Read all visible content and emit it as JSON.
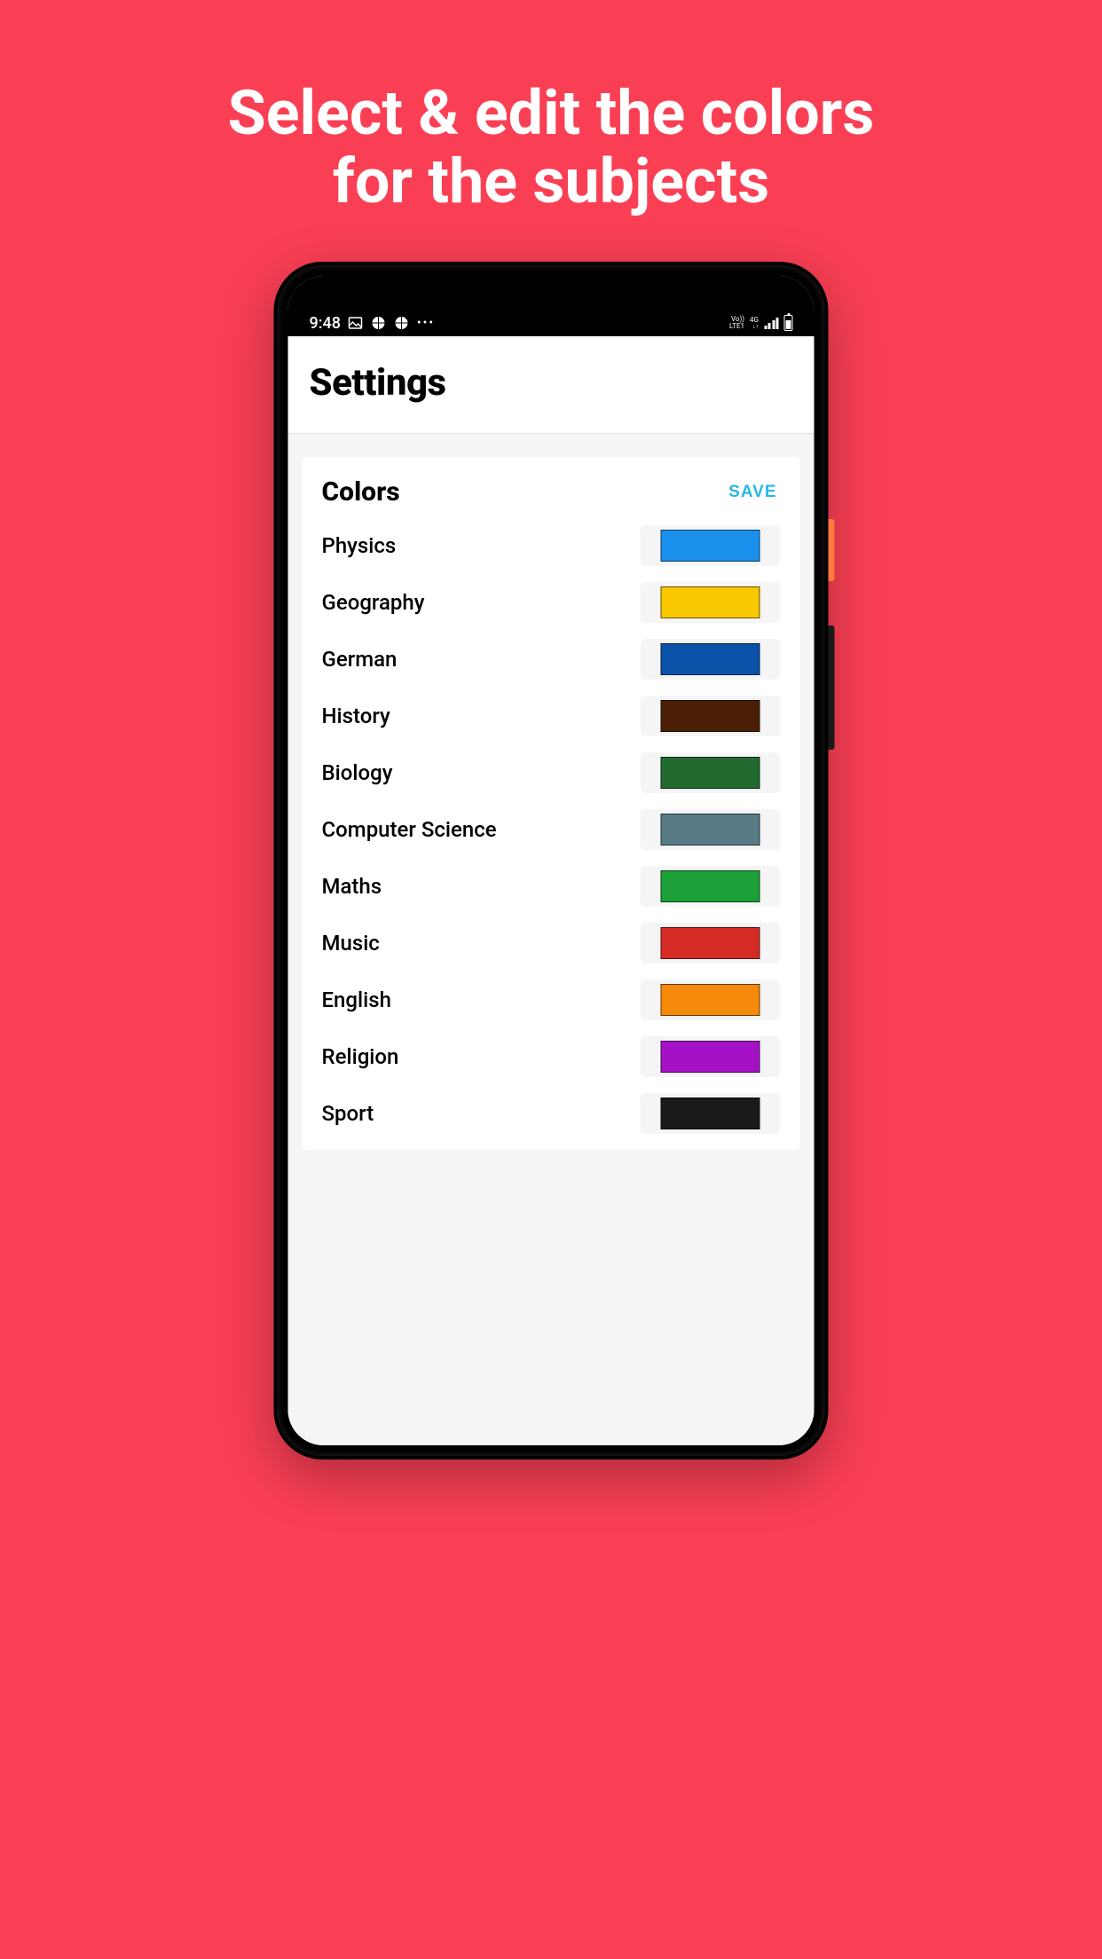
{
  "promo": {
    "title_line1": "Select & edit the colors",
    "title_line2": "for the subjects"
  },
  "status_bar": {
    "time": "9:48",
    "network_line1": "Vo))",
    "network_line2": "LTE1",
    "network_4g": "4G"
  },
  "header": {
    "title": "Settings"
  },
  "card": {
    "title": "Colors",
    "save_label": "SAVE"
  },
  "subjects": [
    {
      "name": "Physics",
      "color": "#1a90ed"
    },
    {
      "name": "Geography",
      "color": "#fac800"
    },
    {
      "name": "German",
      "color": "#0a52a8"
    },
    {
      "name": "History",
      "color": "#4a1f05"
    },
    {
      "name": "Biology",
      "color": "#226b30"
    },
    {
      "name": "Computer Science",
      "color": "#577c85"
    },
    {
      "name": "Maths",
      "color": "#1ca038"
    },
    {
      "name": "Music",
      "color": "#d42c25"
    },
    {
      "name": "English",
      "color": "#f58a0a"
    },
    {
      "name": "Religion",
      "color": "#a512c6"
    },
    {
      "name": "Sport",
      "color": "#1a1a1a"
    }
  ]
}
